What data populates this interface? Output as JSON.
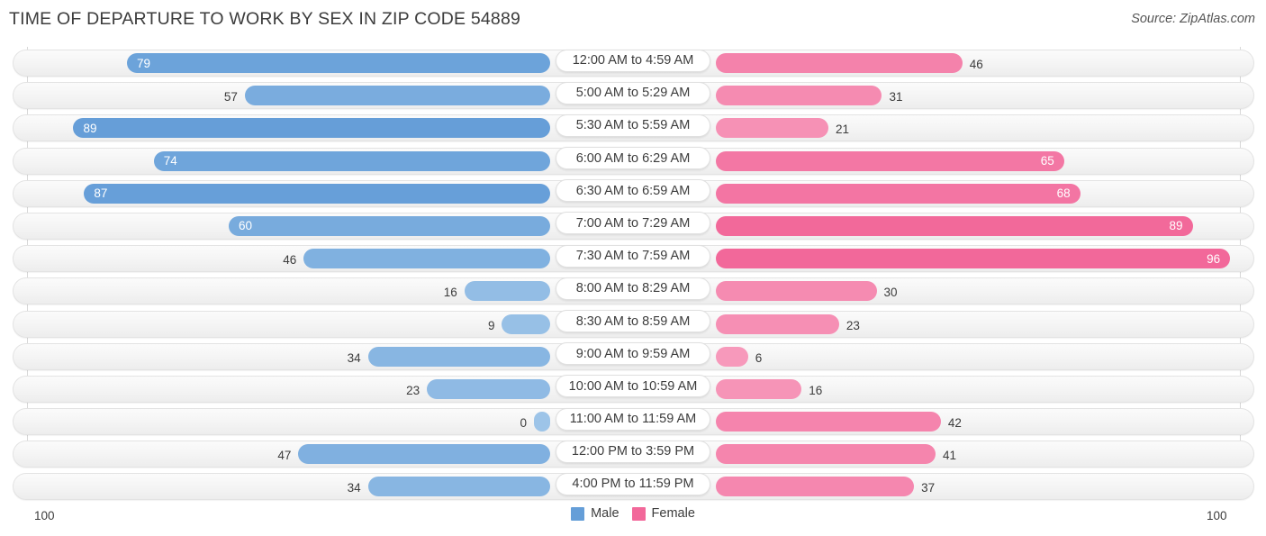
{
  "header": {
    "title": "TIME OF DEPARTURE TO WORK BY SEX IN ZIP CODE 54889",
    "source": "Source: ZipAtlas.com"
  },
  "axis": {
    "left_max": "100",
    "right_max": "100"
  },
  "legend": {
    "items": [
      {
        "label": "Male",
        "color": "#659ed8"
      },
      {
        "label": "Female",
        "color": "#f2689a"
      }
    ]
  },
  "colors": {
    "male": "#659ed8",
    "female": "#f2689a",
    "male_light": "#9dc4e8",
    "female_light": "#f79dbd",
    "track": "#f4f4f4",
    "gridline": "#d8d8d8",
    "text": "#3c3c3c"
  },
  "chart_data": {
    "type": "bar",
    "orientation": "horizontal",
    "layout": "diverging-bidirectional",
    "title": "TIME OF DEPARTURE TO WORK BY SEX IN ZIP CODE 54889",
    "xlabel": "",
    "ylabel": "",
    "xlim": [
      100,
      100
    ],
    "axis_left_label": "100",
    "axis_right_label": "100",
    "grid": true,
    "legend_position": "bottom-center",
    "categories": [
      "12:00 AM to 4:59 AM",
      "5:00 AM to 5:29 AM",
      "5:30 AM to 5:59 AM",
      "6:00 AM to 6:29 AM",
      "6:30 AM to 6:59 AM",
      "7:00 AM to 7:29 AM",
      "7:30 AM to 7:59 AM",
      "8:00 AM to 8:29 AM",
      "8:30 AM to 8:59 AM",
      "9:00 AM to 9:59 AM",
      "10:00 AM to 10:59 AM",
      "11:00 AM to 11:59 AM",
      "12:00 PM to 3:59 PM",
      "4:00 PM to 11:59 PM"
    ],
    "series": [
      {
        "name": "Male",
        "color": "#659ed8",
        "values": [
          79,
          57,
          89,
          74,
          87,
          60,
          46,
          16,
          9,
          34,
          23,
          0,
          47,
          34
        ]
      },
      {
        "name": "Female",
        "color": "#f2689a",
        "values": [
          46,
          31,
          21,
          65,
          68,
          89,
          96,
          30,
          23,
          6,
          16,
          42,
          41,
          37
        ]
      }
    ]
  },
  "rows": [
    {
      "category": "12:00 AM to 4:59 AM",
      "male": 79,
      "female": 46,
      "male_inside": true,
      "female_inside": false
    },
    {
      "category": "5:00 AM to 5:29 AM",
      "male": 57,
      "female": 31,
      "male_inside": false,
      "female_inside": false
    },
    {
      "category": "5:30 AM to 5:59 AM",
      "male": 89,
      "female": 21,
      "male_inside": true,
      "female_inside": false
    },
    {
      "category": "6:00 AM to 6:29 AM",
      "male": 74,
      "female": 65,
      "male_inside": true,
      "female_inside": true
    },
    {
      "category": "6:30 AM to 6:59 AM",
      "male": 87,
      "female": 68,
      "male_inside": true,
      "female_inside": true
    },
    {
      "category": "7:00 AM to 7:29 AM",
      "male": 60,
      "female": 89,
      "male_inside": true,
      "female_inside": true
    },
    {
      "category": "7:30 AM to 7:59 AM",
      "male": 46,
      "female": 96,
      "male_inside": false,
      "female_inside": true
    },
    {
      "category": "8:00 AM to 8:29 AM",
      "male": 16,
      "female": 30,
      "male_inside": false,
      "female_inside": false
    },
    {
      "category": "8:30 AM to 8:59 AM",
      "male": 9,
      "female": 23,
      "male_inside": false,
      "female_inside": false
    },
    {
      "category": "9:00 AM to 9:59 AM",
      "male": 34,
      "female": 6,
      "male_inside": false,
      "female_inside": false
    },
    {
      "category": "10:00 AM to 10:59 AM",
      "male": 23,
      "female": 16,
      "male_inside": false,
      "female_inside": false
    },
    {
      "category": "11:00 AM to 11:59 AM",
      "male": 0,
      "female": 42,
      "male_inside": false,
      "female_inside": false
    },
    {
      "category": "12:00 PM to 3:59 PM",
      "male": 47,
      "female": 41,
      "male_inside": false,
      "female_inside": false
    },
    {
      "category": "4:00 PM to 11:59 PM",
      "male": 34,
      "female": 37,
      "male_inside": false,
      "female_inside": false
    }
  ]
}
